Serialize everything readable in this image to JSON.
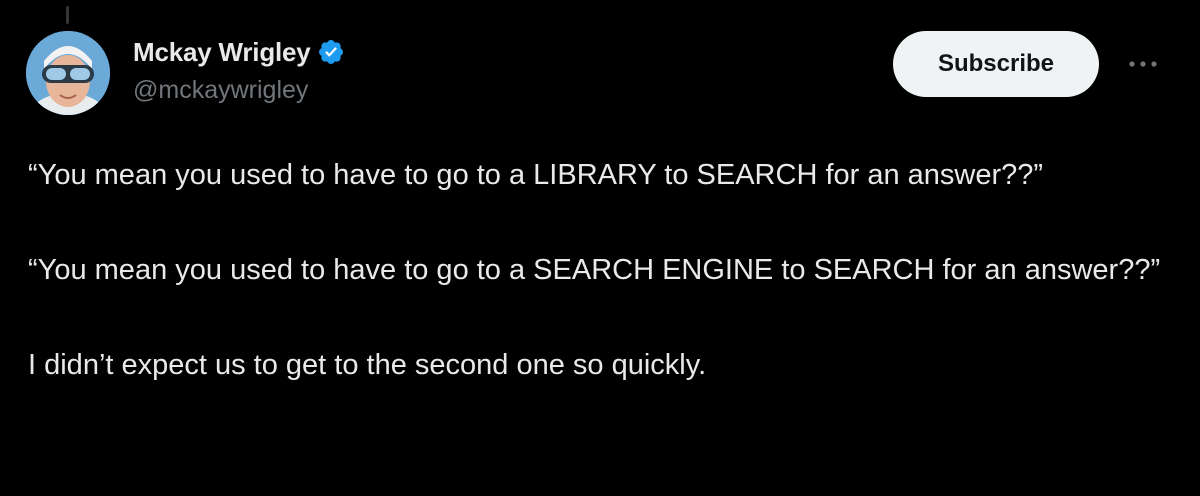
{
  "author": {
    "display_name": "Mckay Wrigley",
    "handle": "@mckaywrigley",
    "verified": true,
    "verified_color": "#1d9bf0"
  },
  "actions": {
    "subscribe_label": "Subscribe",
    "more_icon": "more-horizontal-icon"
  },
  "tweet": {
    "paragraphs": [
      "“You mean you used to have to go to a LIBRARY to SEARCH for an answer??”",
      "“You mean you used to have to go to a SEARCH ENGINE to SEARCH for an answer??”",
      "I didn’t expect us to get to the second one so quickly."
    ]
  },
  "colors": {
    "background": "#000000",
    "primary_text": "#e7e9ea",
    "secondary_text": "#71767b",
    "button_bg": "#eff3f4",
    "button_text": "#0f1419"
  }
}
